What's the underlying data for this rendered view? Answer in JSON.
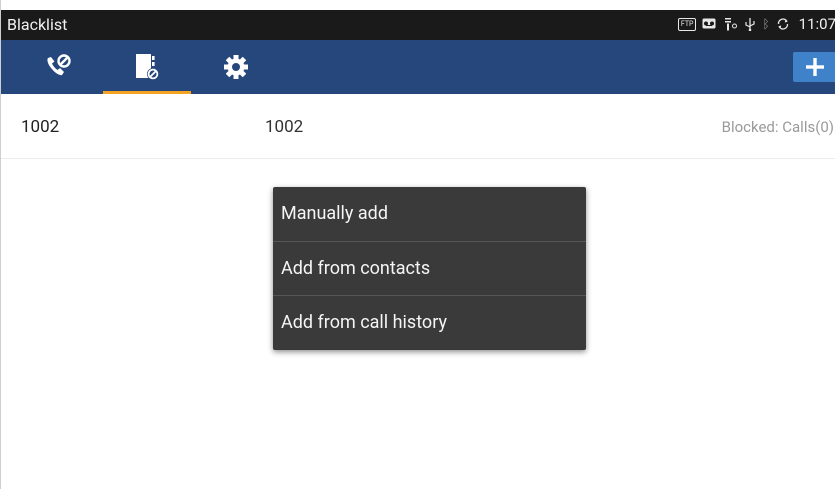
{
  "statusbar": {
    "title": "Blacklist",
    "icons": [
      "ftp-icon",
      "voicemail-icon",
      "signal-icon",
      "usb-icon",
      "bluetooth-icon",
      "sync-icon"
    ],
    "time": "11:07"
  },
  "toolbar": {
    "tabs": [
      {
        "name": "blocked-calls",
        "icon": "phone-blocked-icon",
        "active": false
      },
      {
        "name": "blacklist-contacts",
        "icon": "contact-block-icon",
        "active": true
      },
      {
        "name": "settings",
        "icon": "gear-icon",
        "active": false
      }
    ],
    "add_icon": "plus-icon",
    "colors": {
      "bar": "#25477c",
      "indicator": "#f4a323",
      "add_button": "#3f82c9"
    }
  },
  "list": {
    "rows": [
      {
        "number": "1002",
        "name": "1002",
        "status": "Blocked: Calls(0)"
      }
    ]
  },
  "menu": {
    "items": [
      "Manually add",
      "Add from contacts",
      "Add from call history"
    ]
  }
}
